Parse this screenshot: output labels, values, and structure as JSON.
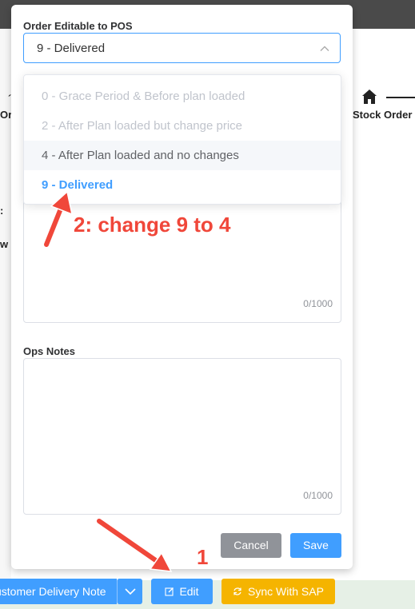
{
  "background": {
    "left_fragments": [
      "´",
      "Or",
      ":",
      "w"
    ],
    "stock_order_label": "Stock Order"
  },
  "modal": {
    "field_label": "Order Editable to POS",
    "select_value": "9 - Delivered",
    "options": [
      {
        "label": "0 - Grace Period & Before plan loaded",
        "state": "disabled"
      },
      {
        "label": "2 - After Plan loaded but change price",
        "state": "disabled"
      },
      {
        "label": "4 - After Plan loaded and no changes",
        "state": "hover"
      },
      {
        "label": "9 - Delivered",
        "state": "selected"
      }
    ],
    "notes_counter": "0/1000",
    "ops_notes_label": "Ops Notes",
    "ops_notes_counter": "0/1000",
    "cancel_label": "Cancel",
    "save_label": "Save"
  },
  "footer": {
    "delivery_note_label": "ustomer Delivery Note",
    "edit_label": "Edit",
    "sync_label": "Sync With SAP"
  },
  "annotations": {
    "step1": "1",
    "step2": "2: change 9 to 4"
  },
  "colors": {
    "primary": "#409eff",
    "warning": "#f5b400",
    "annotation": "#f0473a",
    "cancel": "#909399"
  }
}
